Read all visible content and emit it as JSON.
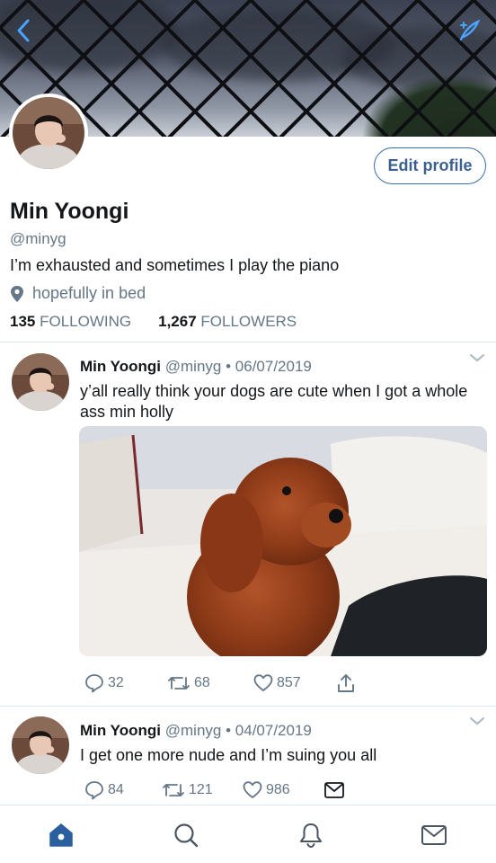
{
  "profile": {
    "name": "Min Yoongi",
    "handle": "@minyg",
    "bio": "I’m exhausted and sometimes I play the piano",
    "location": "hopefully in bed",
    "following_count": "135",
    "following_label": "FOLLOWING",
    "followers_count": "1,267",
    "followers_label": "FOLLOWERS",
    "edit_label": "Edit profile"
  },
  "icons": {
    "back": "chevron-left-icon",
    "compose": "compose-feather-icon",
    "location": "location-pin-icon",
    "reply": "reply-icon",
    "retweet": "retweet-icon",
    "like": "heart-icon",
    "share": "share-icon",
    "dm": "envelope-icon",
    "home": "home-icon",
    "search": "search-icon",
    "notifications": "bell-icon",
    "messages": "envelope-icon"
  },
  "colors": {
    "accent": "#1da1f2",
    "nav_active": "#2a5f9e",
    "muted": "#657786"
  },
  "tweets": [
    {
      "name": "Min Yoongi",
      "handle": "@minyg",
      "separator": "•",
      "date": "06/07/2019",
      "text": "y’all really think your dogs are cute when I got a whole ass min holly",
      "replies": "32",
      "retweets": "68",
      "likes": "857"
    },
    {
      "name": "Min Yoongi",
      "handle": "@minyg",
      "separator": "•",
      "date": "04/07/2019",
      "text": "I get one more nude and I’m suing you all",
      "replies": "84",
      "retweets": "121",
      "likes": "986"
    }
  ]
}
